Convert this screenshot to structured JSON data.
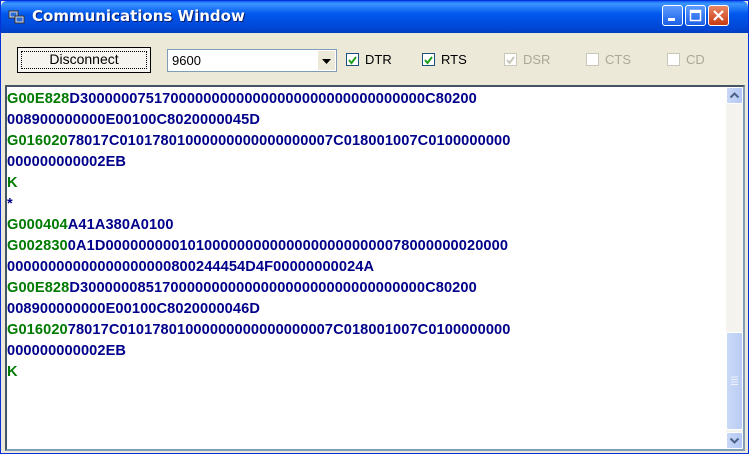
{
  "window": {
    "title": "Communications Window",
    "app_icon": "computers-icon"
  },
  "titlebar_buttons": [
    "minimize-icon",
    "maximize-icon",
    "close-icon"
  ],
  "toolbar": {
    "disconnect_label": "Disconnect",
    "baud_value": "9600",
    "checkboxes": [
      {
        "label": "DTR",
        "checked": true,
        "enabled": true
      },
      {
        "label": "RTS",
        "checked": true,
        "enabled": true
      },
      {
        "label": "DSR",
        "checked": true,
        "enabled": false
      },
      {
        "label": "CTS",
        "checked": false,
        "enabled": false
      },
      {
        "label": "CD",
        "checked": false,
        "enabled": false
      }
    ]
  },
  "terminal": {
    "colors": {
      "green": "#007a00",
      "navy": "#00008b"
    },
    "lines": [
      {
        "prefix": "G00E828",
        "rest": "D300000075170000000000000000000000000000000C80200"
      },
      {
        "prefix": "",
        "rest": "008900000000E00100C8020000045D"
      },
      {
        "prefix": "G016020",
        "rest": "78017C01017801000000000000000007C018001007C0100000000"
      },
      {
        "prefix": "",
        "rest": "000000000002EB"
      },
      {
        "prefix": "K",
        "rest": ""
      },
      {
        "prefix": "",
        "rest": "*"
      },
      {
        "prefix": "G000404",
        "rest": "A41A380A0100"
      },
      {
        "prefix": "G002830",
        "rest": "0A1D0000000001010000000000000000000000078000000020000"
      },
      {
        "prefix": "",
        "rest": "00000000000000000000800244454D4F00000000024A"
      },
      {
        "prefix": "G00E828",
        "rest": "D300000085170000000000000000000000000000000C80200"
      },
      {
        "prefix": "",
        "rest": "008900000000E00100C8020000046D"
      },
      {
        "prefix": "G016020",
        "rest": "78017C01017801000000000000000007C018001007C0100000000"
      },
      {
        "prefix": "",
        "rest": "000000000002EB"
      },
      {
        "prefix": "K",
        "rest": ""
      }
    ]
  }
}
